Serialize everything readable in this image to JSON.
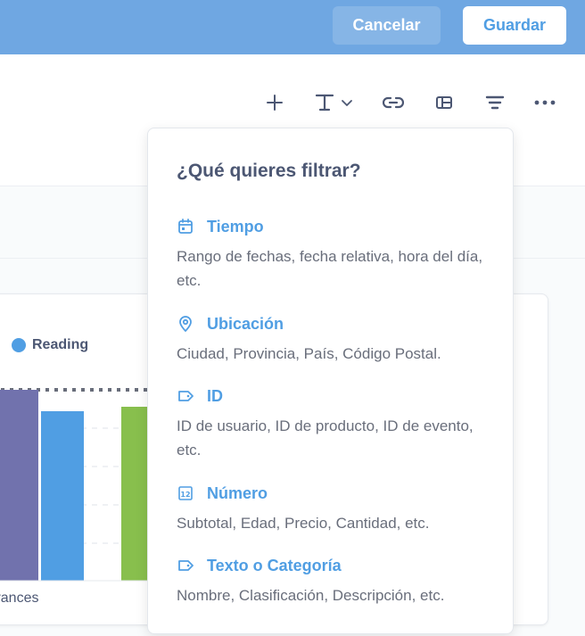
{
  "header": {
    "cancel_label": "Cancelar",
    "save_label": "Guardar",
    "accent_color": "#509ee3"
  },
  "toolbar": {
    "tools": [
      {
        "name": "add",
        "icon": "plus-icon"
      },
      {
        "name": "text",
        "icon": "text-icon"
      },
      {
        "name": "link",
        "icon": "link-icon"
      },
      {
        "name": "section",
        "icon": "layout-icon"
      },
      {
        "name": "filter",
        "icon": "filter-icon"
      },
      {
        "name": "more",
        "icon": "more-icon"
      }
    ]
  },
  "chart": {
    "legend_label": "Reading",
    "legend_color": "#509ee3",
    "x_label": "frances",
    "bar_colors": [
      "#7172ad",
      "#509ee3",
      "#88bf4d"
    ]
  },
  "filter_popover": {
    "title": "¿Qué quieres filtrar?",
    "items": [
      {
        "label": "Tiempo",
        "description": "Rango de fechas, fecha relativa, hora del día, etc.",
        "icon": "calendar-icon"
      },
      {
        "label": "Ubicación",
        "description": "Ciudad, Provincia, País, Código Postal.",
        "icon": "location-pin-icon"
      },
      {
        "label": "ID",
        "description": "ID de usuario, ID de producto, ID de evento, etc.",
        "icon": "label-tag-icon"
      },
      {
        "label": "Número",
        "description": "Subtotal, Edad, Precio, Cantidad, etc.",
        "icon": "number-icon"
      },
      {
        "label": "Texto o Categoría",
        "description": "Nombre, Clasificación, Descripción, etc.",
        "icon": "label-tag-icon"
      }
    ]
  }
}
